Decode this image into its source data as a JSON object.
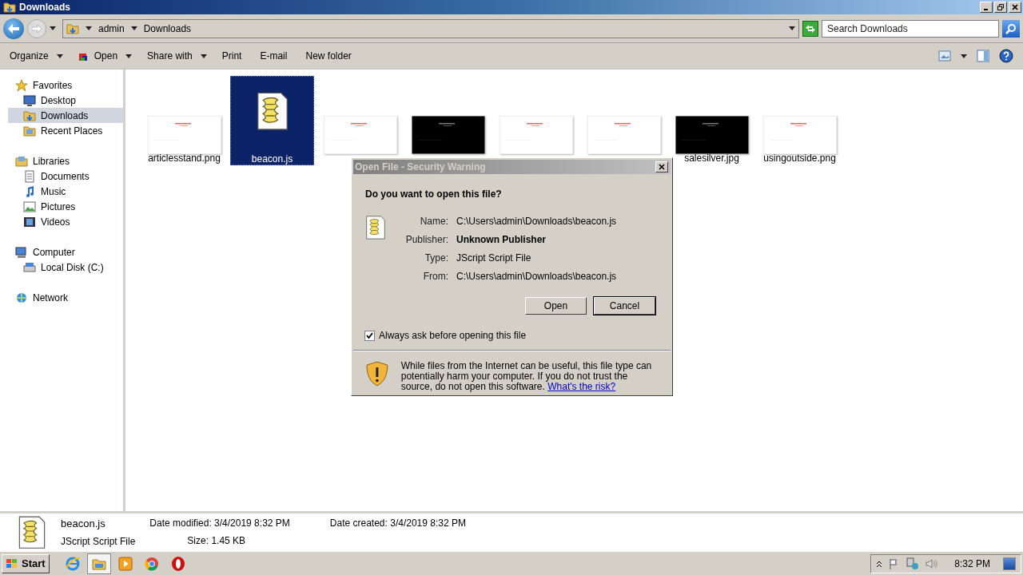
{
  "window": {
    "title": "Downloads"
  },
  "address": {
    "crumbs": [
      "admin",
      "Downloads"
    ]
  },
  "search": {
    "placeholder": "Search Downloads"
  },
  "toolbar": [
    {
      "label": "Organize",
      "dropdown": true,
      "kind": "plain"
    },
    {
      "label": "Open",
      "dropdown": true,
      "kind": "open"
    },
    {
      "label": "Share with",
      "dropdown": true,
      "kind": "plain"
    },
    {
      "label": "Print",
      "dropdown": false,
      "kind": "plain"
    },
    {
      "label": "E-mail",
      "dropdown": false,
      "kind": "plain"
    },
    {
      "label": "New folder",
      "dropdown": false,
      "kind": "plain"
    }
  ],
  "sidebar": [
    {
      "label": "Favorites",
      "kind": "star",
      "selected": false,
      "children": [
        {
          "label": "Desktop",
          "kind": "desktop",
          "selected": false
        },
        {
          "label": "Downloads",
          "kind": "folder",
          "selected": true
        },
        {
          "label": "Recent Places",
          "kind": "recent",
          "selected": false
        }
      ]
    },
    {
      "label": "Libraries",
      "kind": "library",
      "selected": false,
      "children": [
        {
          "label": "Documents",
          "kind": "doc",
          "selected": false
        },
        {
          "label": "Music",
          "kind": "music",
          "selected": false
        },
        {
          "label": "Pictures",
          "kind": "pictures",
          "selected": false
        },
        {
          "label": "Videos",
          "kind": "video",
          "selected": false
        }
      ]
    },
    {
      "label": "Computer",
      "kind": "computer",
      "selected": false,
      "children": [
        {
          "label": "Local Disk (C:)",
          "kind": "disk",
          "selected": false
        }
      ]
    },
    {
      "label": "Network",
      "kind": "network",
      "selected": false
    }
  ],
  "files": [
    {
      "name": "articlesstand.png",
      "kind": "light",
      "selected": false
    },
    {
      "name": "beacon.js",
      "kind": "script",
      "selected": true
    },
    {
      "kind": "light",
      "selected": false
    },
    {
      "kind": "dark",
      "selected": false
    },
    {
      "kind": "light",
      "selected": false
    },
    {
      "kind": "light",
      "selected": false
    },
    {
      "name": "salesilver.jpg",
      "kind": "dark",
      "selected": false
    },
    {
      "name": "usingoutside.png",
      "kind": "light",
      "selected": false
    }
  ],
  "dialog": {
    "title": "Open File - Security Warning",
    "question": "Do you want to open this file?",
    "rows": [
      {
        "label": "Name:",
        "value": "C:\\Users\\admin\\Downloads\\beacon.js",
        "bold": false
      },
      {
        "label": "Publisher:",
        "value": "Unknown Publisher",
        "bold": true
      },
      {
        "label": "Type:",
        "value": "JScript Script File",
        "bold": false
      },
      {
        "label": "From:",
        "value": "C:\\Users\\admin\\Downloads\\beacon.js",
        "bold": false
      }
    ],
    "buttons": [
      "Open",
      "Cancel"
    ],
    "checkbox": {
      "label": "Always ask before opening this file",
      "checked": true
    },
    "warning": "While files from the Internet can be useful, this file type can potentially harm your computer. If you do not trust the source, do not open this software.",
    "link": "What's the risk?"
  },
  "details": {
    "name": "beacon.js",
    "type": "JScript Script File",
    "fields": [
      {
        "label": "Date modified:",
        "value": "3/4/2019 8:32 PM"
      },
      {
        "label": "Size:",
        "value": "1.45 KB"
      },
      {
        "label": "Date created:",
        "value": "3/4/2019 8:32 PM"
      }
    ]
  },
  "taskbar": {
    "start": "Start",
    "apps": [
      {
        "kind": "ie",
        "selected": false
      },
      {
        "kind": "explorer",
        "selected": true
      },
      {
        "kind": "media",
        "selected": false
      },
      {
        "kind": "chrome",
        "selected": false
      },
      {
        "kind": "opera",
        "selected": false
      }
    ],
    "clock": "8:32 PM"
  }
}
